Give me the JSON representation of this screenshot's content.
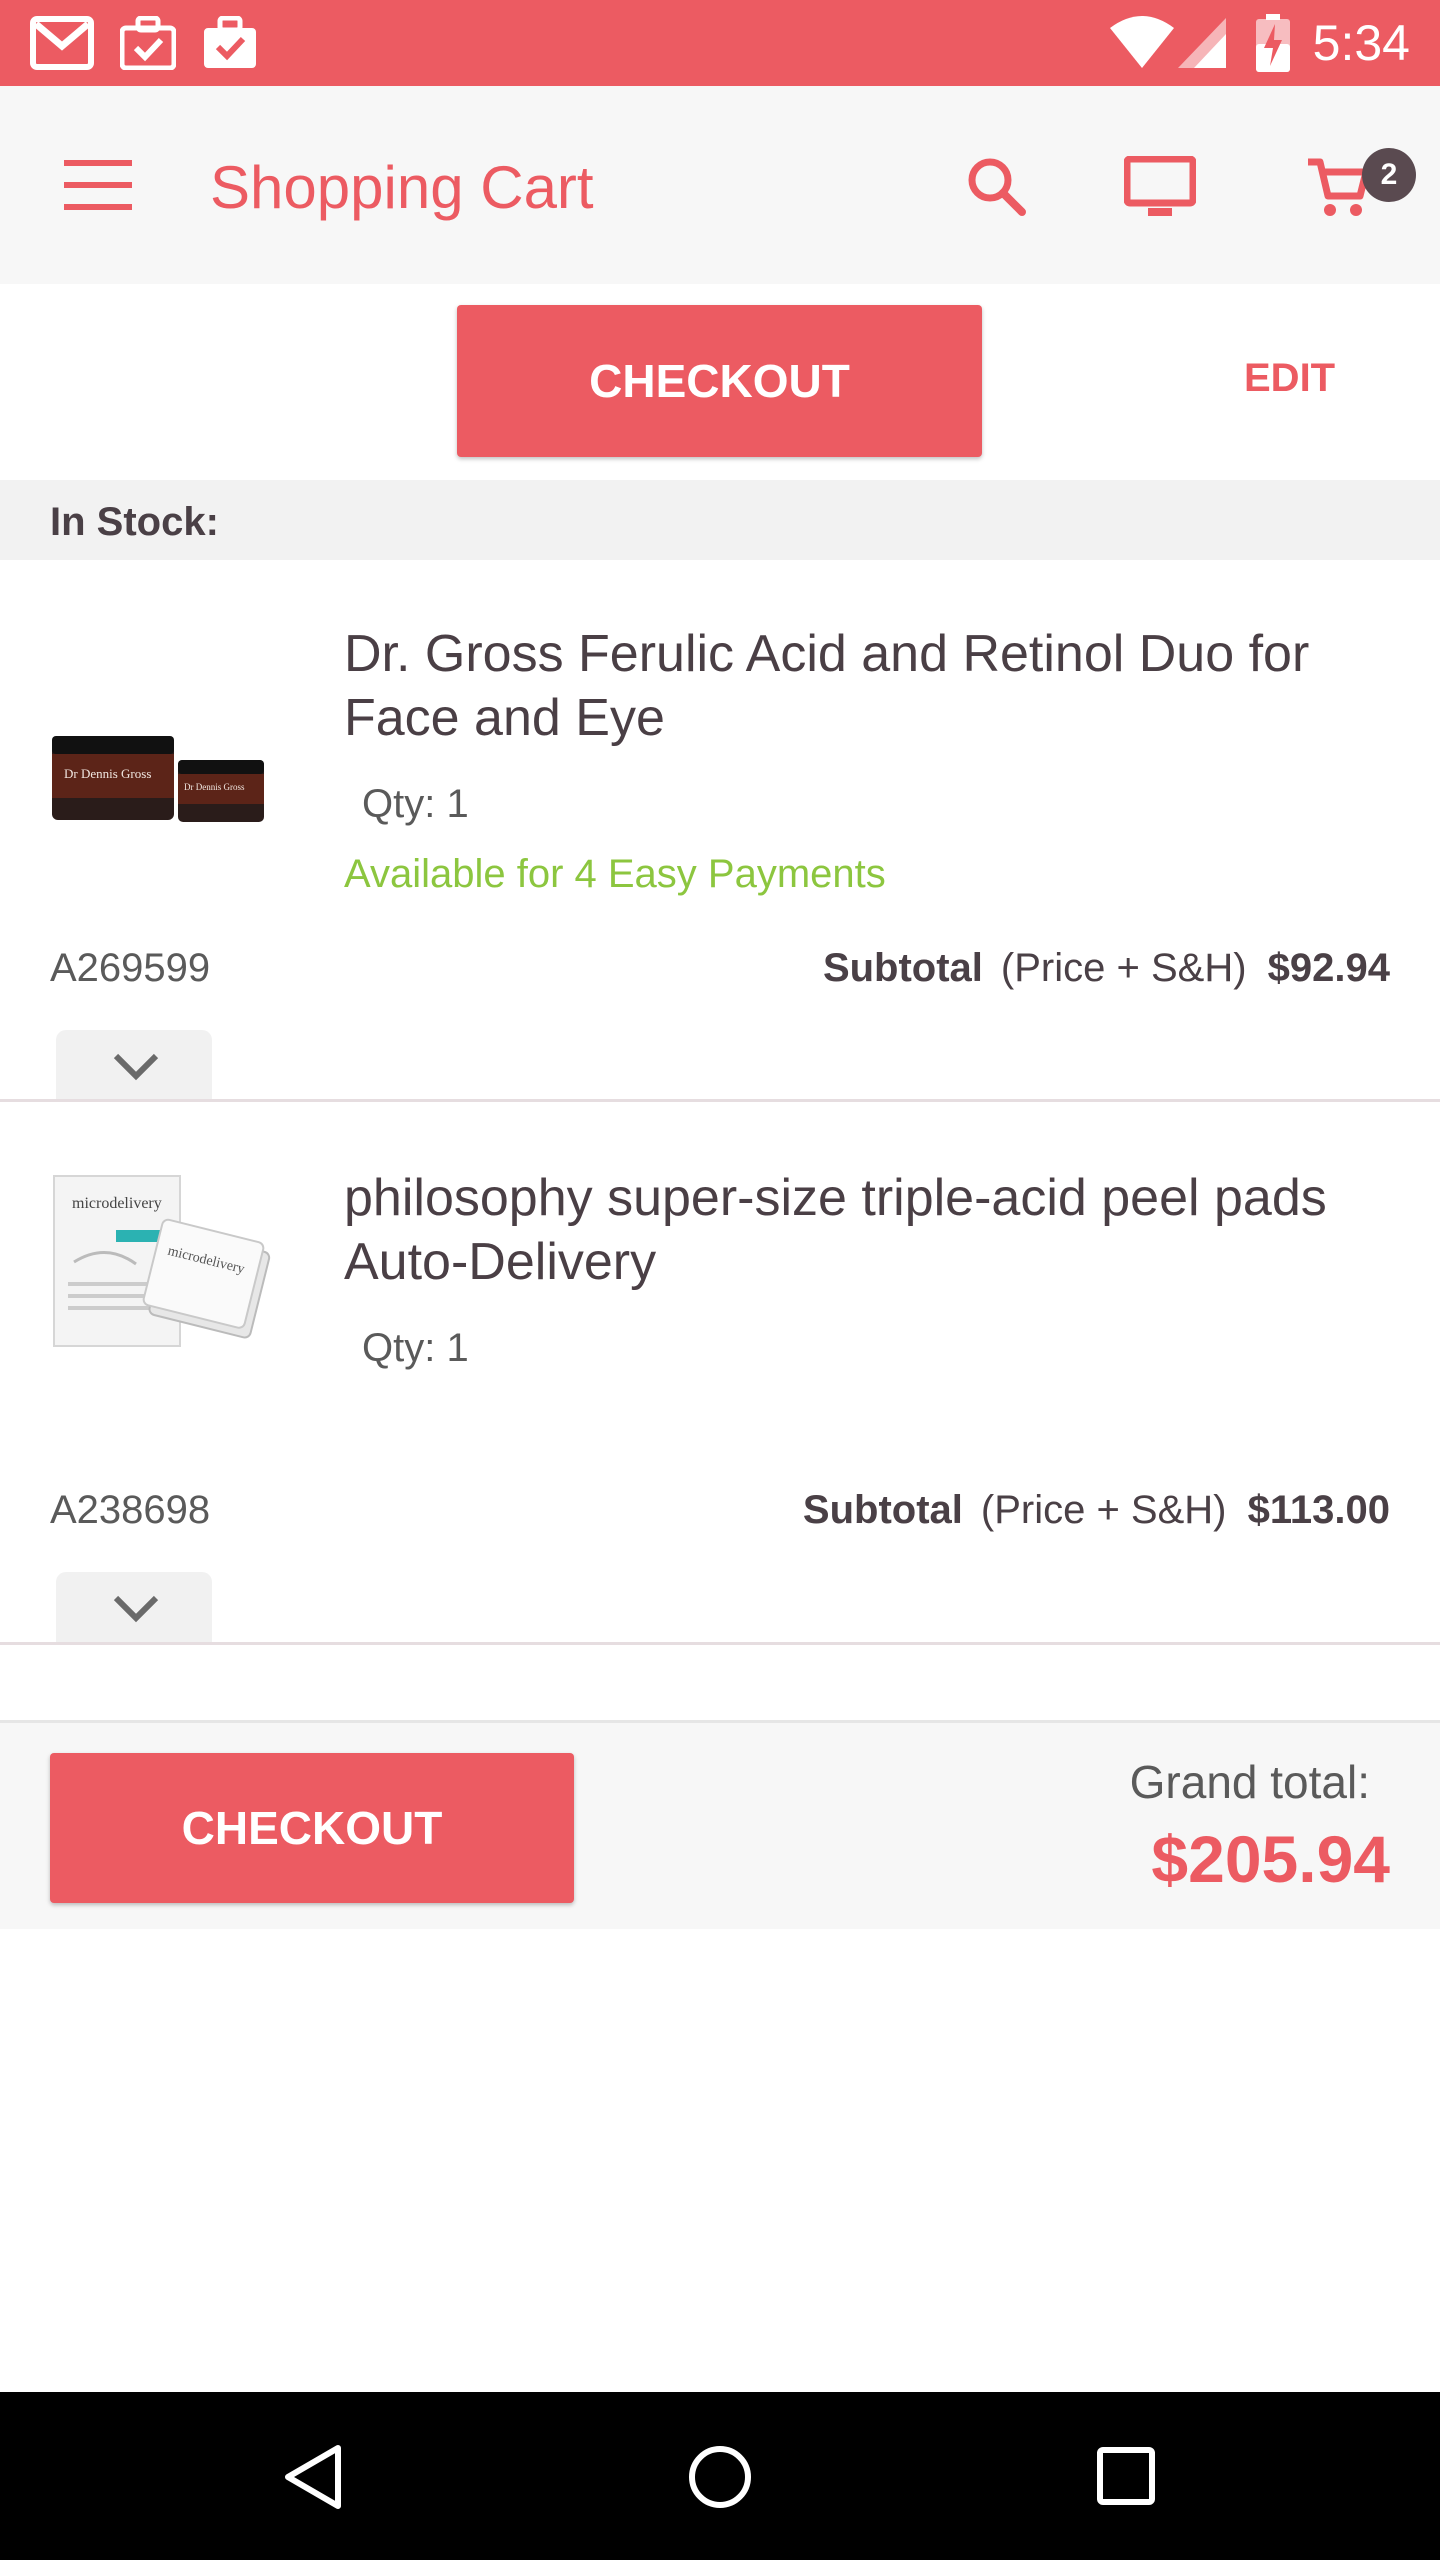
{
  "status_bar": {
    "time": "5:34",
    "icons": [
      "gmail-icon",
      "briefcase-check-icon",
      "briefcase-check-icon-2",
      "wifi-icon",
      "signal-icon",
      "battery-icon"
    ]
  },
  "app_bar": {
    "title": "Shopping Cart",
    "cart_count": "2",
    "icons": [
      "menu-icon",
      "search-icon",
      "tv-icon",
      "cart-icon"
    ]
  },
  "actions": {
    "checkout_label": "CHECKOUT",
    "edit_label": "EDIT"
  },
  "section": {
    "label": "In Stock:"
  },
  "items": [
    {
      "title": "Dr. Gross Ferulic Acid and Retinol Duo for Face and Eye",
      "qty": "Qty: 1",
      "payments": "Available for 4 Easy Payments",
      "sku": "A269599",
      "subtotal_label": "Subtotal",
      "subtotal_note": "(Price + S&H)",
      "subtotal_value": "$92.94",
      "image_text_1": "Dr Dennis Gross",
      "image_text_2": "Dr Dennis Gross"
    },
    {
      "title": "philosophy super-size triple-acid peel pads Auto-Delivery",
      "qty": "Qty: 1",
      "sku": "A238698",
      "subtotal_label": "Subtotal",
      "subtotal_note": "(Price + S&H)",
      "subtotal_value": "$113.00",
      "image_text_1": "microdelivery",
      "image_text_2": "microdelivery"
    }
  ],
  "footer": {
    "checkout_label": "CHECKOUT",
    "grand_total_label": "Grand total:",
    "grand_total_value": "$205.94"
  },
  "colors": {
    "accent": "#ec5b62",
    "payments_green": "#8cc63f",
    "badge": "#5a4a50",
    "nav_bar": "#000000"
  }
}
